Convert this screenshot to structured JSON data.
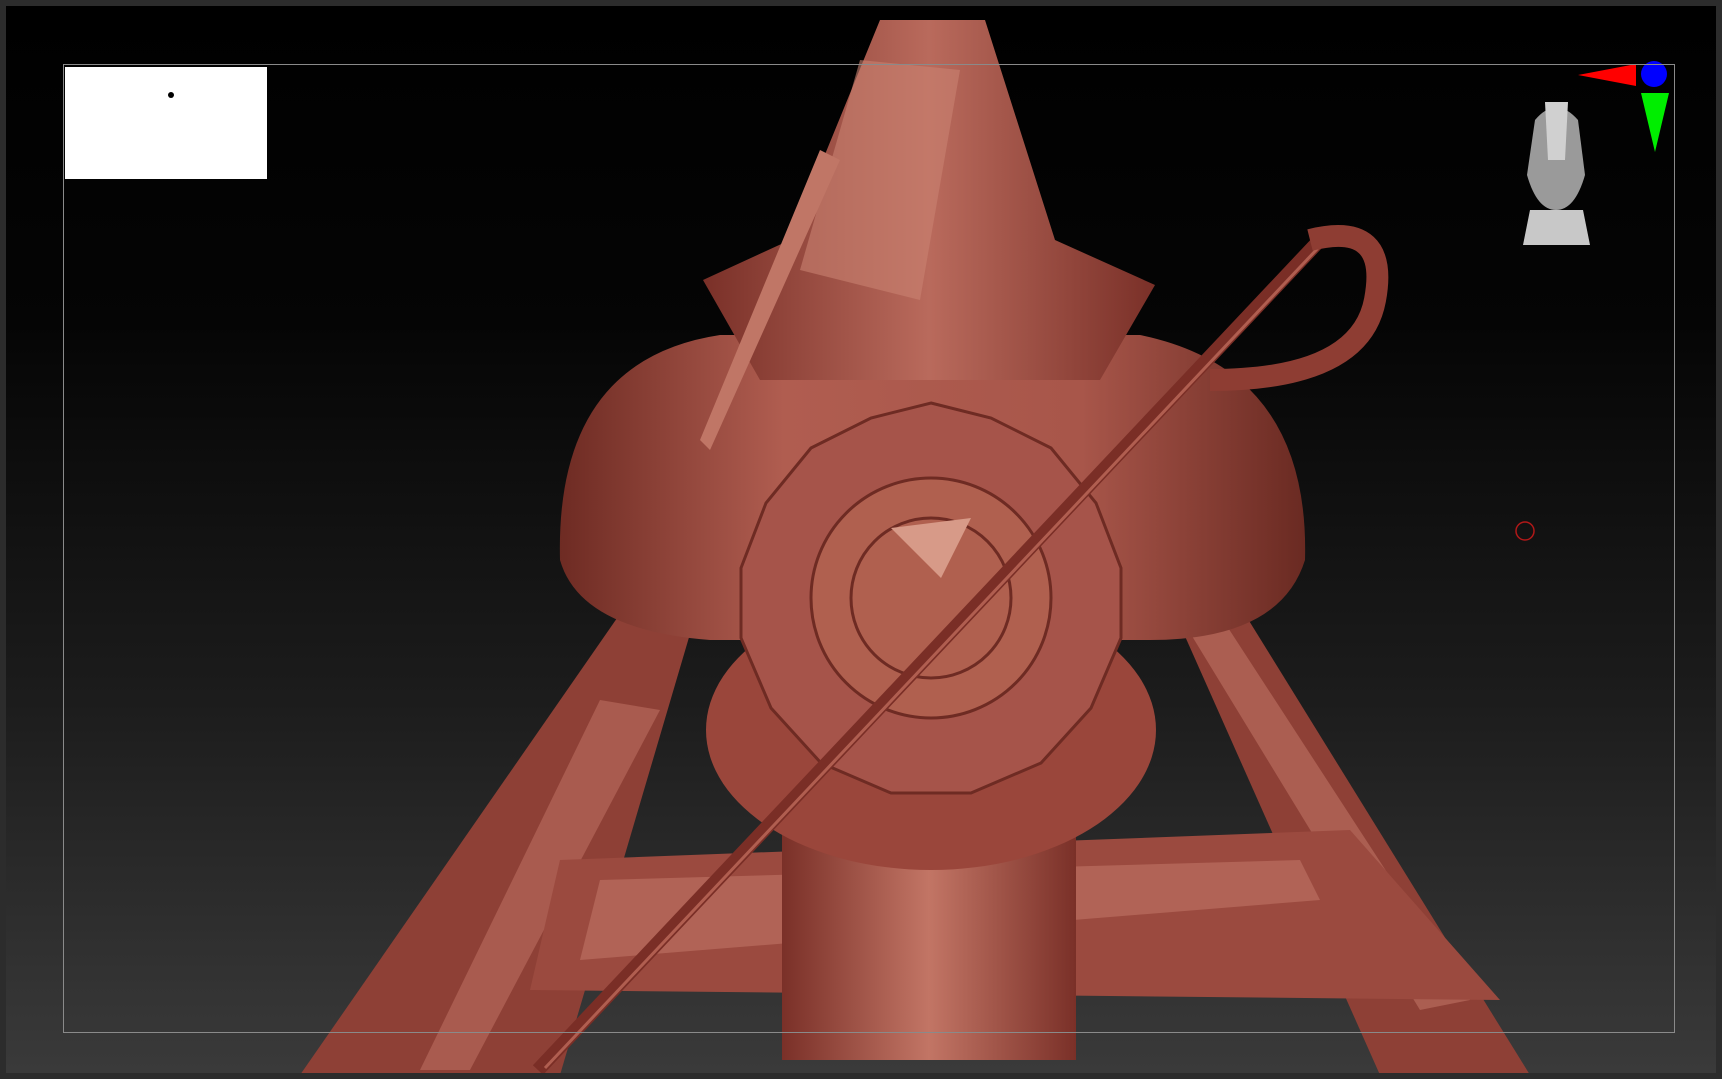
{
  "viewport": {
    "background_top": "#000000",
    "background_bottom": "#3a3a3a",
    "frame_color": "#8a8a8a"
  },
  "model": {
    "base_color": "#9a4a3f",
    "highlight_color": "#c26e60",
    "shadow_color": "#5e251e"
  },
  "gizmo": {
    "x_axis_color": "#ff0000",
    "y_axis_color": "#00ee00",
    "z_axis_color": "#0000ff",
    "icons": [
      "axis-gizmo-icon",
      "orientation-head-icon"
    ]
  },
  "cursor": {
    "color": "#b01818",
    "icon": "brush-cursor-icon"
  }
}
